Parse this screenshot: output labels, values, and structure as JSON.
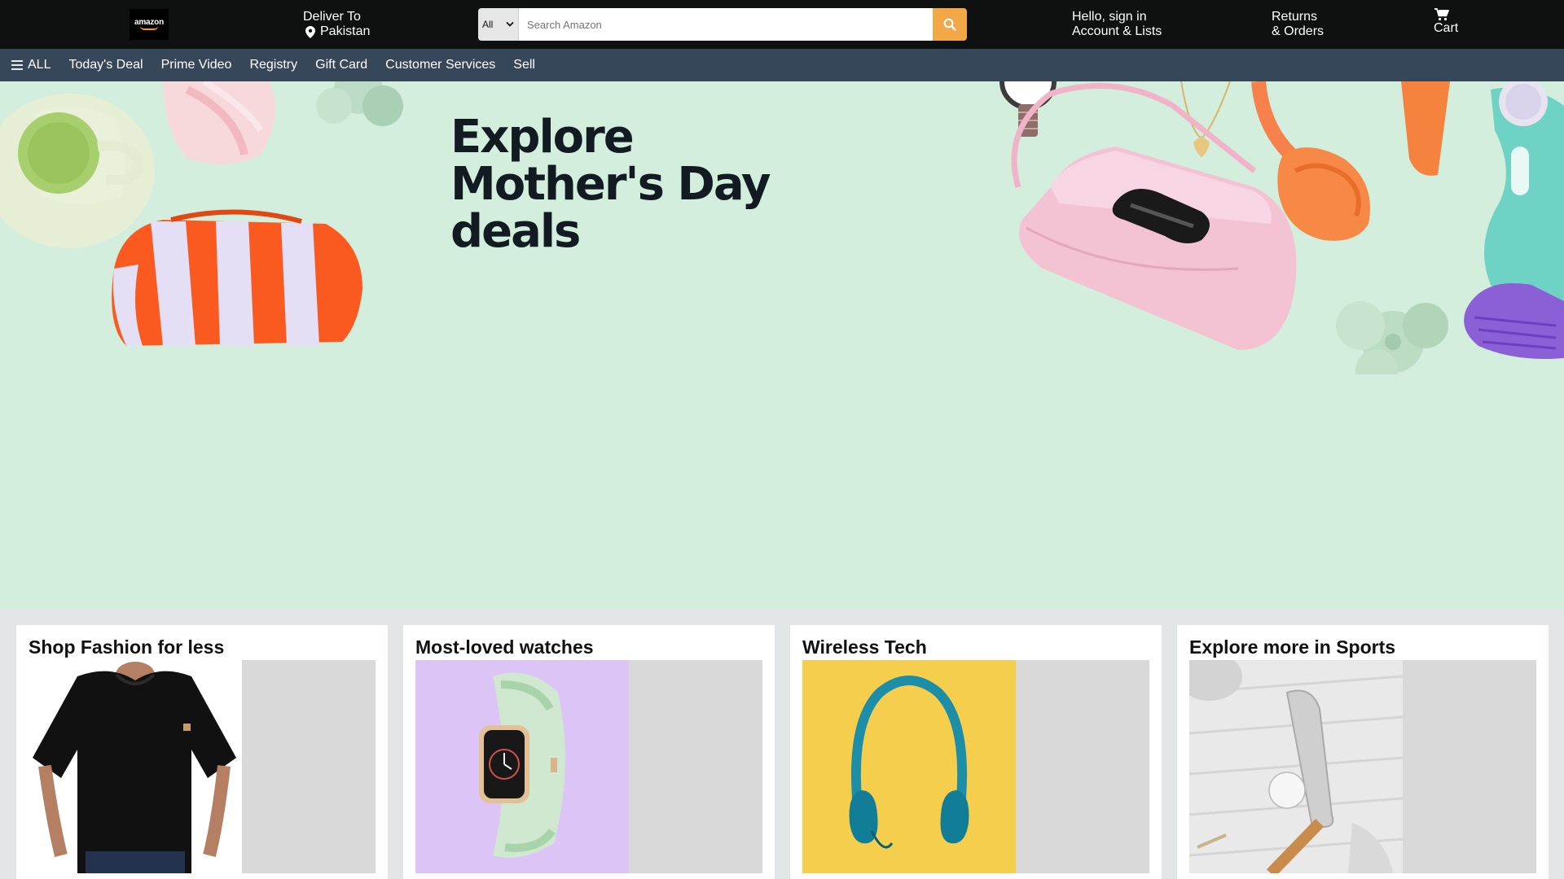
{
  "header": {
    "logo_text": "amazon",
    "deliver_label": "Deliver To",
    "deliver_location": "Pakistan",
    "search_category": "All",
    "search_placeholder": "Search Amazon",
    "account_greeting": "Hello, sign in",
    "account_lists": "Account & Lists",
    "returns_line1": "Returns",
    "returns_line2": "& Orders",
    "cart_label": "Cart"
  },
  "subnav": {
    "all_label": "ALL",
    "items": [
      "Today's Deal",
      "Prime Video",
      "Registry",
      "Gift Card",
      "Customer Services",
      "Sell"
    ]
  },
  "hero": {
    "title": "Explore Mother's Day deals",
    "background": "#d3eedc"
  },
  "cards": [
    {
      "title": "Shop Fashion for less"
    },
    {
      "title": "Most-loved watches"
    },
    {
      "title": "Wireless Tech"
    },
    {
      "title": "Explore more in Sports"
    }
  ],
  "colors": {
    "header_bg": "#0f1111",
    "subnav_bg": "#37475a",
    "search_button": "#f3a847",
    "page_bg": "#e3e6e6"
  }
}
